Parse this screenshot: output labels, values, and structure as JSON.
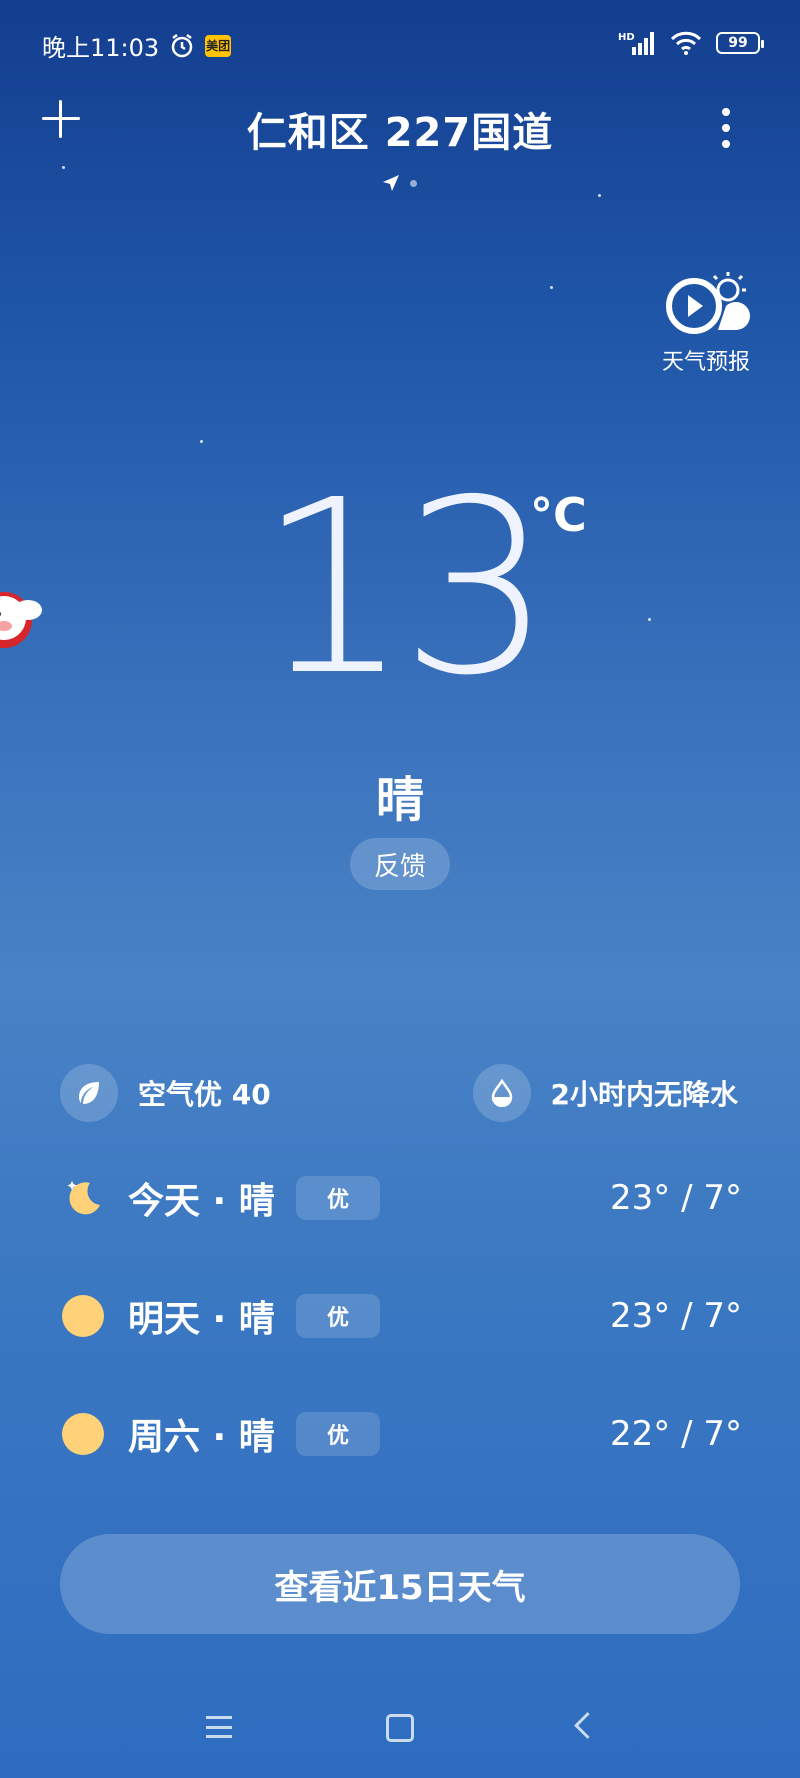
{
  "status_bar": {
    "time": "晚上11:03",
    "app_badge": "美团",
    "network": "HD",
    "battery": "99"
  },
  "header": {
    "location": "仁和区 227国道"
  },
  "forecast_video": {
    "label": "天气预报"
  },
  "current": {
    "temperature": "13",
    "unit": "°C",
    "condition": "晴",
    "feedback_label": "反馈"
  },
  "info": {
    "air_quality": "空气优 40",
    "precipitation": "2小时内无降水"
  },
  "daily": [
    {
      "day": "今天 · 晴",
      "aqi": "优",
      "range": "23° / 7°",
      "icon": "moon-icon"
    },
    {
      "day": "明天 · 晴",
      "aqi": "优",
      "range": "23° / 7°",
      "icon": "sun-icon"
    },
    {
      "day": "周六 · 晴",
      "aqi": "优",
      "range": "22° / 7°",
      "icon": "sun-icon"
    }
  ],
  "more_button": "查看近15日天气",
  "colors": {
    "sun": "#ffd27a",
    "badge_yellow": "#ffc300"
  }
}
